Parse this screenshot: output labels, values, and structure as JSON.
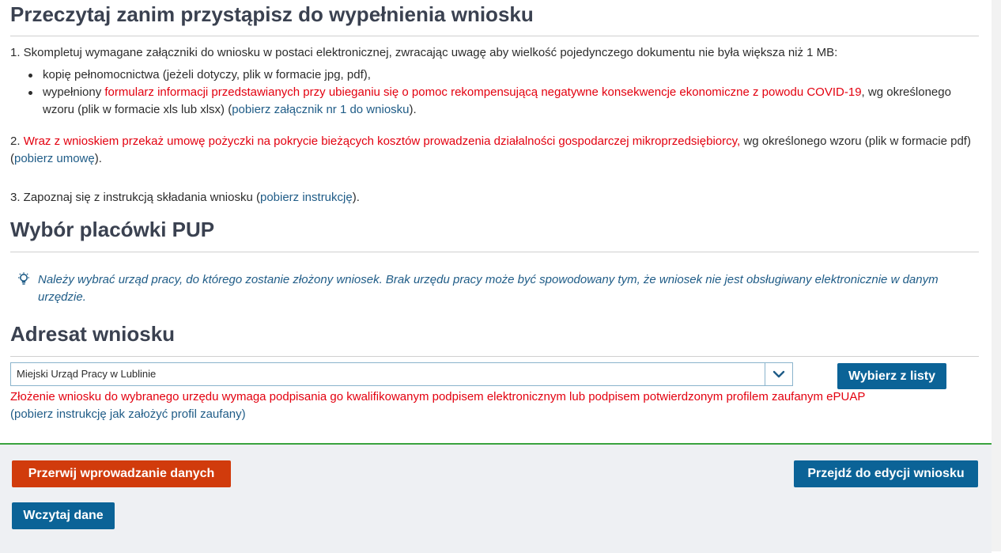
{
  "header": {
    "title": "Przeczytaj zanim przystąpisz do wypełnienia wniosku"
  },
  "instructions": {
    "item1": "1. Skompletuj wymagane załączniki do wniosku w postaci elektronicznej, zwracając uwagę aby wielkość pojedynczego dokumentu nie była większa niż 1 MB:",
    "bullet1": "kopię pełnomocnictwa (jeżeli dotyczy, plik w formacie jpg, pdf),",
    "bullet2_prefix": "wypełniony ",
    "bullet2_red": "formularz informacji przedstawianych przy ubieganiu się o pomoc rekompensującą negatywne konsekwencje ekonomiczne z powodu COVID-19",
    "bullet2_mid": ", wg określonego wzoru (plik w formacie xls lub xlsx) (",
    "bullet2_link": "pobierz załącznik nr 1 do wniosku",
    "bullet2_suffix": ").",
    "item2_prefix": "2. ",
    "item2_red": "Wraz z wnioskiem przekaż umowę pożyczki na pokrycie bieżących kosztów prowadzenia działalności gospodarczej mikroprzedsiębiorcy,",
    "item2_mid": " wg określonego wzoru (plik w formacie pdf) (",
    "item2_link": "pobierz umowę",
    "item2_suffix": ").",
    "item3_prefix": "3. Zapoznaj się z instrukcją składania wniosku (",
    "item3_link": "pobierz instrukcję",
    "item3_suffix": ")."
  },
  "pup_section": {
    "title": "Wybór placówki PUP",
    "info_icon": "lightbulb-icon",
    "info_text": "Należy wybrać urząd pracy, do którego zostanie złożony wniosek. Brak urzędu pracy może być spowodowany tym, że wniosek nie jest obsługiwany elektronicznie w danym urzędzie."
  },
  "addressee": {
    "title": "Adresat wniosku",
    "selected_value": "Miejski Urząd Pracy w Lublinie",
    "chevron_icon": "chevron-down-icon",
    "choose_button": "Wybierz z listy",
    "warning_red": "Złożenie wniosku do wybranego urzędu wymaga podpisania go kwalifikowanym podpisem elektronicznym lub podpisem potwierdzonym profilem zaufanym ePUAP",
    "warning_link": "(pobierz instrukcję jak założyć profil zaufany)"
  },
  "footer": {
    "cancel_button": "Przerwij wprowadzanie danych",
    "next_button": "Przejdź do edycji wniosku",
    "load_button": "Wczytaj dane"
  },
  "colors": {
    "primary": "#0b6397",
    "danger_button": "#d13b0c",
    "required_red": "#e3000f",
    "link": "#1f5c87",
    "footer_bg": "#eef0f3",
    "footer_border": "#3aa33e"
  }
}
